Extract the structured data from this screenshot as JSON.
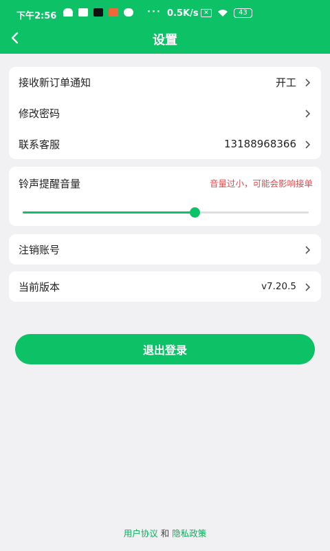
{
  "status_bar": {
    "time": "下午2:56",
    "dots": "···",
    "speed": "0.5K/s",
    "battery": "43"
  },
  "header": {
    "title": "设置"
  },
  "settings": {
    "new_order_notice": {
      "label": "接收新订单通知",
      "value": "开工"
    },
    "change_password": {
      "label": "修改密码"
    },
    "contact_service": {
      "label": "联系客服",
      "value": "13188968366"
    }
  },
  "volume": {
    "label": "铃声提醒音量",
    "warning": "音量过小，可能会影响接单",
    "level": 0.6
  },
  "account": {
    "deactivate": {
      "label": "注销账号"
    },
    "version": {
      "label": "当前版本",
      "value": "v7.20.5"
    }
  },
  "logout_label": "退出登录",
  "footer": {
    "user_agreement": "用户协议",
    "and": " 和 ",
    "privacy_policy": "隐私政策"
  },
  "colors": {
    "brand": "#0cc166",
    "warning": "#e04848",
    "background": "#f1f1f3"
  }
}
